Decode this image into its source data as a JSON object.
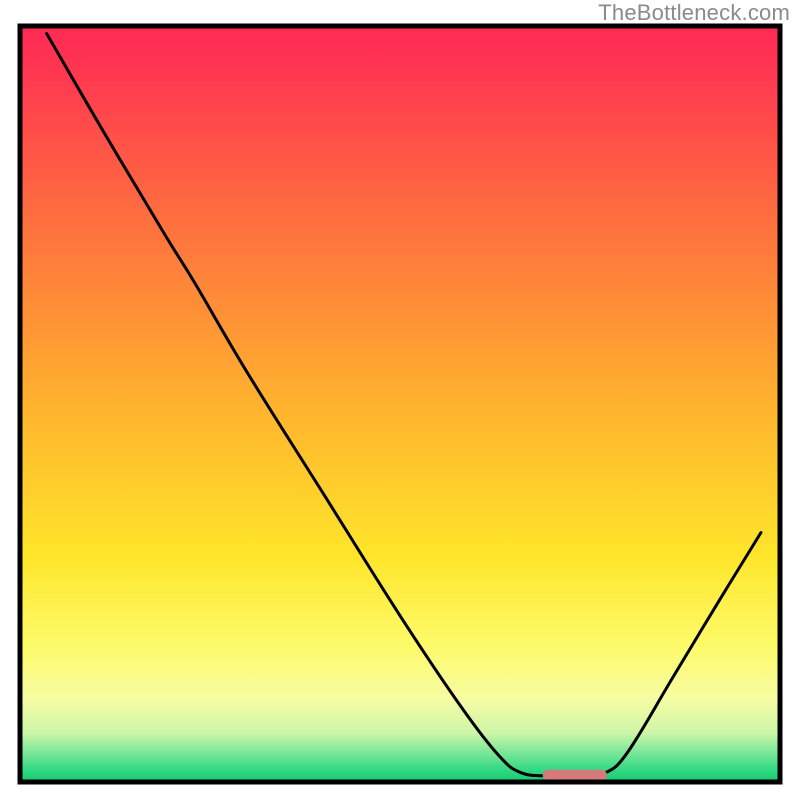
{
  "watermark": "TheBottleneck.com",
  "chart_data": {
    "type": "line",
    "title": "",
    "xlabel": "",
    "ylabel": "",
    "xlim": [
      0,
      100
    ],
    "ylim": [
      0,
      100
    ],
    "background_gradient_vertical": [
      {
        "pos": 0.0,
        "color": "#ff2a55"
      },
      {
        "pos": 0.05,
        "color": "#ff3452"
      },
      {
        "pos": 0.25,
        "color": "#ff6d3f"
      },
      {
        "pos": 0.5,
        "color": "#ffb22e"
      },
      {
        "pos": 0.7,
        "color": "#ffe52a"
      },
      {
        "pos": 0.82,
        "color": "#fdfb6a"
      },
      {
        "pos": 0.89,
        "color": "#f7fca2"
      },
      {
        "pos": 0.935,
        "color": "#cdf6a8"
      },
      {
        "pos": 0.96,
        "color": "#7ee79a"
      },
      {
        "pos": 0.985,
        "color": "#2fd884"
      },
      {
        "pos": 1.0,
        "color": "#16c96f"
      }
    ],
    "curve": [
      {
        "x": 3.5,
        "y": 99.0
      },
      {
        "x": 11.0,
        "y": 86.0
      },
      {
        "x": 19.0,
        "y": 72.5
      },
      {
        "x": 23.0,
        "y": 66.0
      },
      {
        "x": 30.0,
        "y": 54.0
      },
      {
        "x": 40.0,
        "y": 38.0
      },
      {
        "x": 50.0,
        "y": 22.0
      },
      {
        "x": 58.0,
        "y": 10.0
      },
      {
        "x": 63.0,
        "y": 3.5
      },
      {
        "x": 66.0,
        "y": 1.2
      },
      {
        "x": 70.0,
        "y": 0.8
      },
      {
        "x": 74.0,
        "y": 0.8
      },
      {
        "x": 77.0,
        "y": 1.2
      },
      {
        "x": 80.0,
        "y": 4.0
      },
      {
        "x": 86.0,
        "y": 14.0
      },
      {
        "x": 92.0,
        "y": 24.0
      },
      {
        "x": 97.5,
        "y": 33.0
      }
    ],
    "bottleneck_marker": {
      "x_start": 69.5,
      "x_end": 76.5,
      "y": 0.9,
      "color": "#d47a7a",
      "thickness_px": 11
    },
    "frame_color": "#000000",
    "frame_thickness_px": 5,
    "curve_color": "#000000",
    "curve_thickness_px": 3
  }
}
